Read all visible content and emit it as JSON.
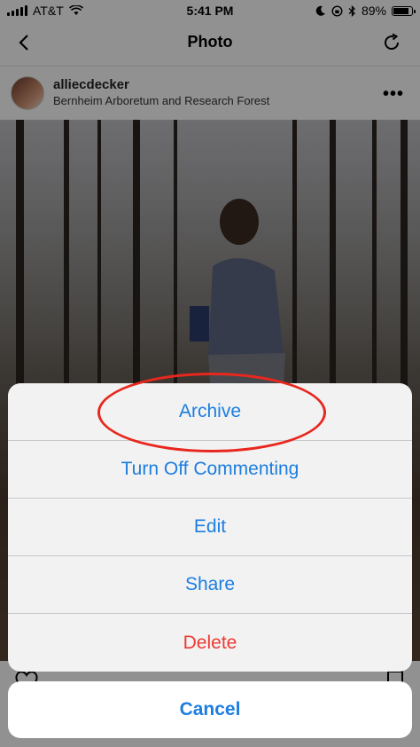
{
  "status_bar": {
    "carrier": "AT&T",
    "time": "5:41 PM",
    "battery": "89%",
    "battery_level": 0.89
  },
  "nav": {
    "title": "Photo"
  },
  "post": {
    "username": "alliecdecker",
    "location": "Bernheim Arboretum and Research Forest"
  },
  "action_sheet": {
    "actions": [
      {
        "label": "Archive"
      },
      {
        "label": "Turn Off Commenting"
      },
      {
        "label": "Edit"
      },
      {
        "label": "Share"
      },
      {
        "label": "Delete"
      }
    ],
    "cancel_label": "Cancel"
  },
  "colors": {
    "action_blue": "#1c7ee0",
    "destructive_red": "#ee3a32",
    "highlight_red": "#e8271e"
  }
}
